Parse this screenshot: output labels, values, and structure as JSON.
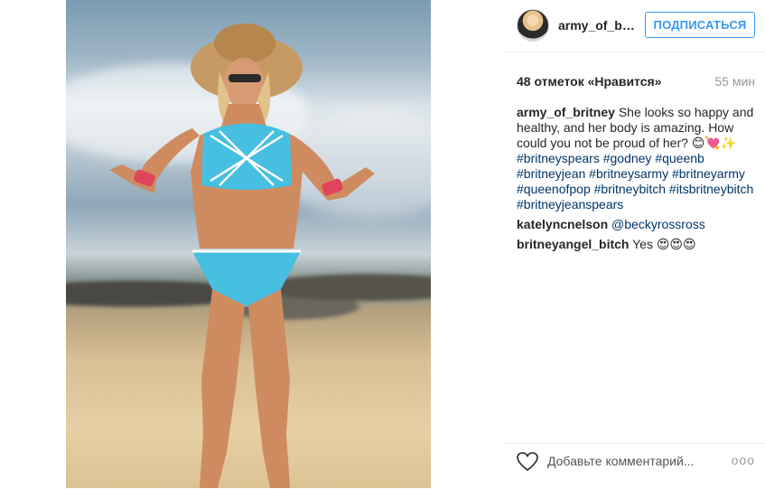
{
  "post": {
    "author": "army_of_britney",
    "author_short": "army_of_br...",
    "follow_label": "ПОДПИСАТЬСЯ",
    "likes_label": "48 отметок «Нравится»",
    "time_label": "55 мин",
    "caption": {
      "user": "army_of_britney",
      "text": "She looks so happy and healthy, and her body is amazing. How could you not be proud of her? 😊💘✨",
      "hashtags_line1": "#britneyspears #godney #queenb",
      "hashtags_line2": "#britneyjean #britneysarmy #britneyarmy",
      "hashtags_line3": "#queenofpop #britneybitch #itsbritneybitch",
      "hashtags_line4": "#britneyjeanspears"
    },
    "comments": [
      {
        "user": "katelyncnelson",
        "mention": "@beckyrossross",
        "text": ""
      },
      {
        "user": "britneyangel_bitch",
        "mention": "",
        "text": "Yes 😍😍😍"
      }
    ],
    "comment_placeholder": "Добавьте комментарий...",
    "more_label": "ooo"
  },
  "icons": {
    "like": "heart-outline-icon",
    "options": "more-options-icon"
  },
  "colors": {
    "link_blue": "#3897f0",
    "hashtag": "#003569",
    "muted": "#999999"
  }
}
